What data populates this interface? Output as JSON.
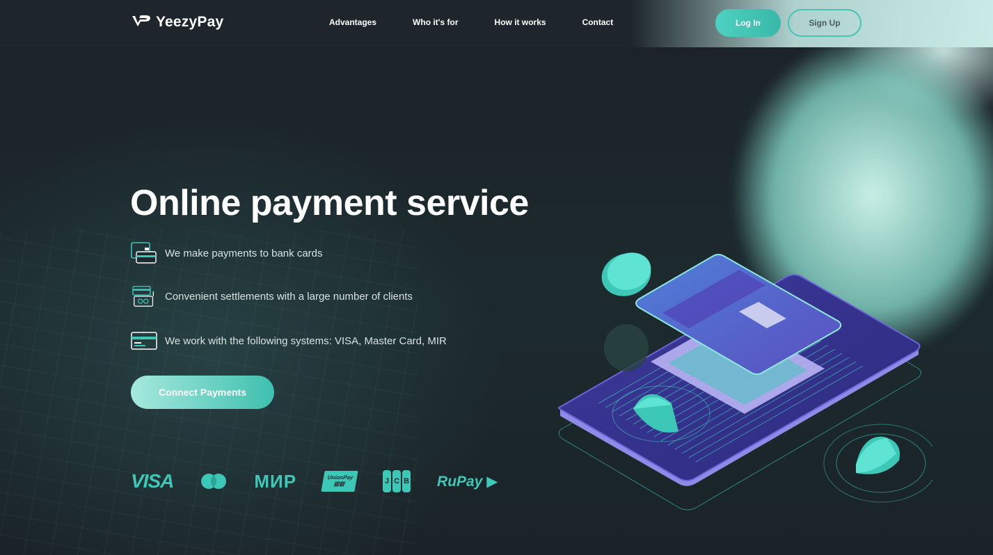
{
  "brand": {
    "name": "YeezyPay",
    "accent": "#3cc7b6"
  },
  "nav": {
    "items": [
      {
        "label": "Advantages"
      },
      {
        "label": "Who it's for"
      },
      {
        "label": "How it works"
      },
      {
        "label": "Contact"
      }
    ],
    "login_label": "Log In",
    "signup_label": "Sign Up"
  },
  "hero": {
    "title": "Online payment service",
    "features": [
      {
        "icon": "bank-card-icon",
        "text": "We make payments to bank cards"
      },
      {
        "icon": "settlement-icon",
        "text": "Convenient settlements with a large number of clients"
      },
      {
        "icon": "card-systems-icon",
        "text": "We work with the following systems: VISA, Master Card, MIR"
      }
    ],
    "cta_label": "Connect Payments"
  },
  "payment_systems": {
    "visa": "VISA",
    "mastercard": "mastercard-logo",
    "mir": "МИР",
    "unionpay_line1": "UnionPay",
    "unionpay_line2": "银联",
    "jcb": [
      "J",
      "C",
      "B"
    ],
    "rupay": "RuPay"
  }
}
